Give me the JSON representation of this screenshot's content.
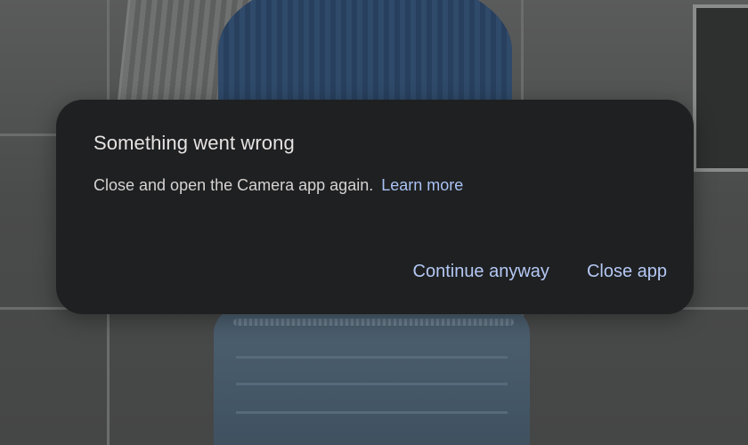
{
  "dialog": {
    "title": "Something went wrong",
    "message": "Close and open the Camera app again.",
    "learn_more": "Learn more",
    "actions": {
      "continue_label": "Continue anyway",
      "close_label": "Close app"
    }
  },
  "colors": {
    "dialog_background": "#1f2021",
    "title_text": "#e6e3e2",
    "body_text": "#d6d3d2",
    "accent": "#b4c8f5"
  }
}
